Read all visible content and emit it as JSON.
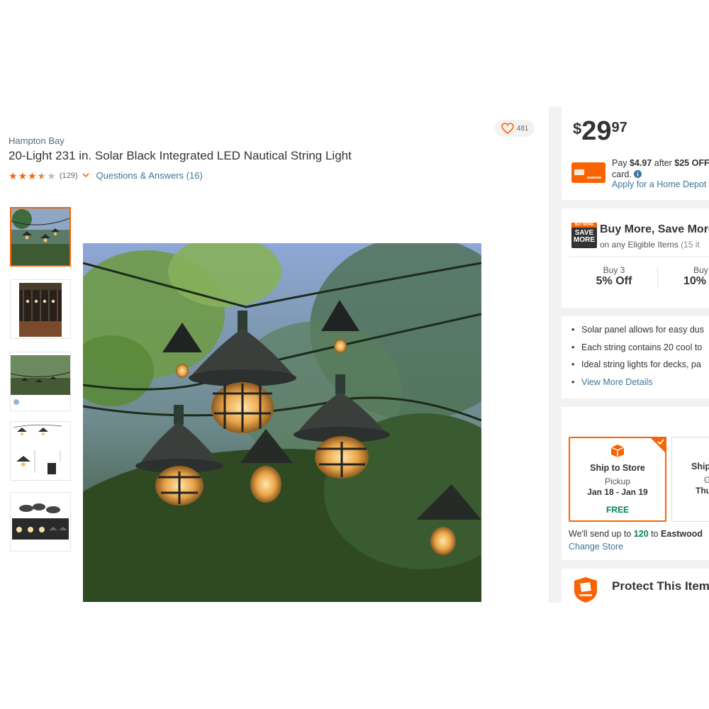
{
  "product": {
    "brand": "Hampton Bay",
    "title": "20-Light 231 in. Solar Black Integrated LED Nautical String Light",
    "rating": 3.5,
    "review_count": "(129)",
    "qa_link": "Questions & Answers (16)",
    "favorites": "481"
  },
  "gallery": {
    "thumbnail_count": 5,
    "selected_index": 0
  },
  "price": {
    "dollar_sign": "$",
    "whole": "29",
    "cents": "97"
  },
  "credit_offer": {
    "pay_prefix": "Pay ",
    "pay_amount": "$4.97",
    "after": " after ",
    "off_amount": "$25 OFF",
    "card_line": "card.",
    "apply_link": "Apply for a Home Depot"
  },
  "buy_more": {
    "badge_top": "BUY MORE",
    "badge_mid": "SAVE",
    "badge_bot": "MORE",
    "title": "Buy More, Save More",
    "subtitle": "on any Eligible Items",
    "subtitle_count": "(15 it",
    "tiers": [
      {
        "qty": "Buy 3",
        "discount": "5% Off"
      },
      {
        "qty": "Buy",
        "discount": "10%"
      }
    ]
  },
  "highlights": {
    "bullets": [
      "Solar panel allows for easy dus",
      "Each string contains 20 cool to",
      "Ideal string lights for decks, pa"
    ],
    "view_more": "View More Details"
  },
  "fulfillment": {
    "options": [
      {
        "title": "Ship to Store",
        "subtitle": "Pickup",
        "date": "Jan 18 - Jan 19",
        "price": "FREE"
      },
      {
        "title": "Ship",
        "subtitle": "G",
        "date": "Thu",
        "price": ""
      }
    ],
    "send_prefix": "We'll send up to ",
    "send_qty": "120",
    "send_suffix": " to ",
    "send_store": "Eastwood",
    "change_store": "Change Store"
  },
  "protection": {
    "title": "Protect This Item"
  },
  "colors": {
    "accent": "#f96302",
    "link": "#3e7697",
    "free_green": "#00805a"
  }
}
